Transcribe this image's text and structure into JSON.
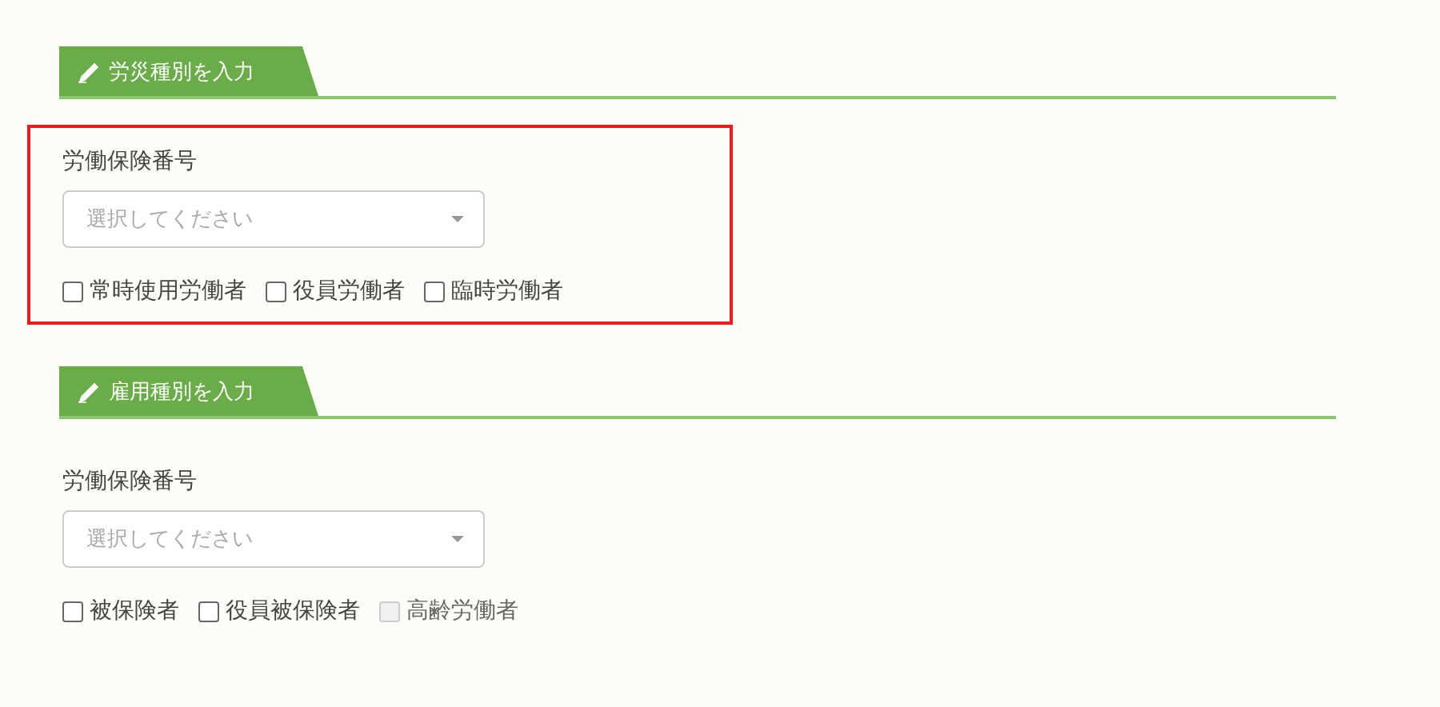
{
  "sections": [
    {
      "title": "労災種別を入力",
      "highlighted": true,
      "field": {
        "label": "労働保険番号",
        "placeholder": "選択してください"
      },
      "checkboxes": [
        {
          "label": "常時使用労働者",
          "checked": false,
          "disabled": false
        },
        {
          "label": "役員労働者",
          "checked": false,
          "disabled": false
        },
        {
          "label": "臨時労働者",
          "checked": false,
          "disabled": false
        }
      ]
    },
    {
      "title": "雇用種別を入力",
      "highlighted": false,
      "field": {
        "label": "労働保険番号",
        "placeholder": "選択してください"
      },
      "checkboxes": [
        {
          "label": "被保険者",
          "checked": false,
          "disabled": false
        },
        {
          "label": "役員被保険者",
          "checked": false,
          "disabled": false
        },
        {
          "label": "高齢労働者",
          "checked": false,
          "disabled": true
        }
      ]
    }
  ]
}
